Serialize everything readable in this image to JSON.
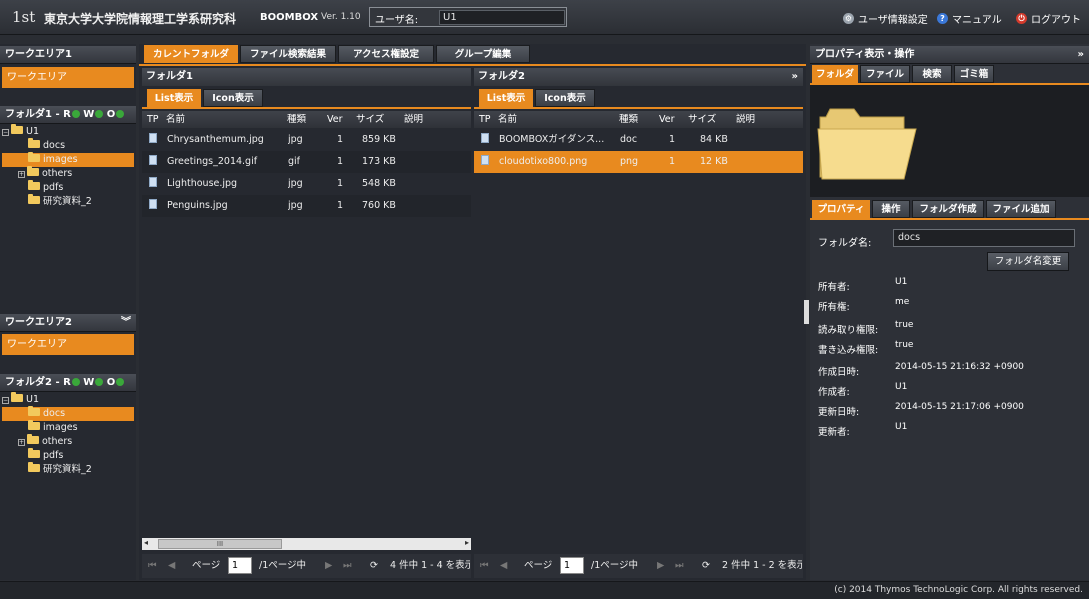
{
  "header": {
    "logo": "1st",
    "org_name": "東京大学大学院情報理工学系研究科",
    "brand": "BOOMBOX",
    "version": "Ver. 1.10",
    "user_label": "ユーザ名:",
    "user_value": "U1",
    "links": [
      {
        "label": "ユーザ情報設定",
        "icon": "gear-icon",
        "color": "#9aa3ad"
      },
      {
        "label": "マニュアル",
        "icon": "help-icon",
        "color": "#3b78d8"
      },
      {
        "label": "ログアウト",
        "icon": "power-icon",
        "color": "#d33a2c"
      }
    ]
  },
  "left": {
    "workarea1_title": "ワークエリア1",
    "workarea1_label": "ワークエリア",
    "folder1_title": "フォルダ1 - R",
    "folder1_w": "W",
    "folder1_o": "O",
    "folder1_tree": {
      "root": "U1",
      "children": [
        {
          "name": "docs",
          "expandable": false
        },
        {
          "name": "images",
          "expandable": false
        },
        {
          "name": "others",
          "expandable": true
        },
        {
          "name": "pdfs",
          "expandable": false
        },
        {
          "name": "研究資料_2",
          "expandable": false
        }
      ]
    },
    "workarea2_title": "ワークエリア2",
    "workarea2_label": "ワークエリア",
    "folder2_title": "フォルダ2 - R",
    "folder2_w": "W",
    "folder2_o": "O",
    "folder2_tree": {
      "root": "U1",
      "children": [
        {
          "name": "docs",
          "expandable": false
        },
        {
          "name": "images",
          "expandable": false
        },
        {
          "name": "others",
          "expandable": true
        },
        {
          "name": "pdfs",
          "expandable": false
        },
        {
          "name": "研究資料_2",
          "expandable": false
        }
      ]
    }
  },
  "tabs": [
    "カレントフォルダ",
    "ファイル検索結果",
    "アクセス権設定",
    "グループ編集"
  ],
  "pane1": {
    "title": "フォルダ1",
    "view_tabs": [
      "List表示",
      "Icon表示"
    ],
    "columns": [
      "TP",
      "名前",
      "種類",
      "Ver",
      "サイズ",
      "説明"
    ],
    "rows": [
      {
        "name": "Chrysanthemum.jpg",
        "type": "jpg",
        "ver": "1",
        "size": "859 KB"
      },
      {
        "name": "Greetings_2014.gif",
        "type": "gif",
        "ver": "1",
        "size": "173 KB"
      },
      {
        "name": "Lighthouse.jpg",
        "type": "jpg",
        "ver": "1",
        "size": "548 KB"
      },
      {
        "name": "Penguins.jpg",
        "type": "jpg",
        "ver": "1",
        "size": "760 KB"
      }
    ],
    "scroll_thumb": "III",
    "pager": {
      "page_label": "ページ",
      "page": "1",
      "of": "/1ページ中",
      "summary": "4 件中 1 - 4 を表示"
    }
  },
  "pane2": {
    "title": "フォルダ2",
    "view_tabs": [
      "List表示",
      "Icon表示"
    ],
    "columns": [
      "TP",
      "名前",
      "種類",
      "Ver",
      "サイズ",
      "説明"
    ],
    "rows": [
      {
        "name": "BOOMBOXガイダンス...",
        "type": "doc",
        "ver": "1",
        "size": "84 KB"
      },
      {
        "name": "cloudotixo800.png",
        "type": "png",
        "ver": "1",
        "size": "12 KB"
      }
    ],
    "pager": {
      "page_label": "ページ",
      "page": "1",
      "of": "/1ページ中",
      "summary": "2 件中 1 - 2 を表示"
    }
  },
  "right": {
    "title": "プロパティ表示・操作",
    "top_tabs": [
      "フォルダ",
      "ファイル",
      "検索",
      "ゴミ箱"
    ],
    "prop_tabs": [
      "プロパティ",
      "操作",
      "フォルダ作成",
      "ファイル追加"
    ],
    "folder_name_label": "フォルダ名:",
    "folder_name_value": "docs",
    "rename_button": "フォルダ名変更",
    "props": [
      {
        "label": "所有者:",
        "value": "U1"
      },
      {
        "label": "所有権:",
        "value": "me"
      },
      {
        "label": "読み取り権限:",
        "value": "true"
      },
      {
        "label": "書き込み権限:",
        "value": "true"
      },
      {
        "label": "作成日時:",
        "value": "2014-05-15 21:16:32 +0900"
      },
      {
        "label": "作成者:",
        "value": "U1"
      },
      {
        "label": "更新日時:",
        "value": "2014-05-15 21:17:06 +0900"
      },
      {
        "label": "更新者:",
        "value": "U1"
      }
    ]
  },
  "footer": {
    "copyright": "(c) 2014 Thymos TechnoLogic Corp. All rights reserved."
  }
}
